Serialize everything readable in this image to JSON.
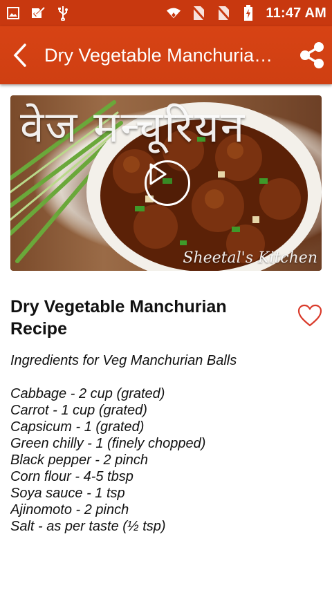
{
  "status_bar": {
    "time": "11:47 AM",
    "left_icons": [
      "image-icon",
      "checkbox-icon",
      "usb-icon"
    ],
    "right_icons": [
      "wifi-icon",
      "no-sim-icon",
      "no-sim-icon",
      "battery-charging-icon"
    ]
  },
  "app_bar": {
    "title": "Dry Vegetable Manchuria…",
    "back_icon": "back-arrow-icon",
    "share_icon": "share-icon",
    "color": "#d24213"
  },
  "video": {
    "hindi_title": "वेज मन्चूरियन",
    "watermark": "Sheetal's Kitchen",
    "play_icon": "play-icon"
  },
  "recipe": {
    "title": "Dry Vegetable Manchurian Recipe",
    "favorite_icon": "heart-outline-icon",
    "section_heading": "Ingredients for Veg Manchurian Balls",
    "ingredients": [
      "Cabbage - 2 cup (grated)",
      "Carrot - 1 cup (grated)",
      "Capsicum - 1 (grated)",
      "Green chilly - 1 (finely chopped)",
      "Black pepper - 2 pinch",
      "Corn flour - 4-5 tbsp",
      "Soya sauce - 1 tsp",
      "Ajinomoto - 2 pinch",
      "Salt - as per taste (½ tsp)"
    ]
  }
}
